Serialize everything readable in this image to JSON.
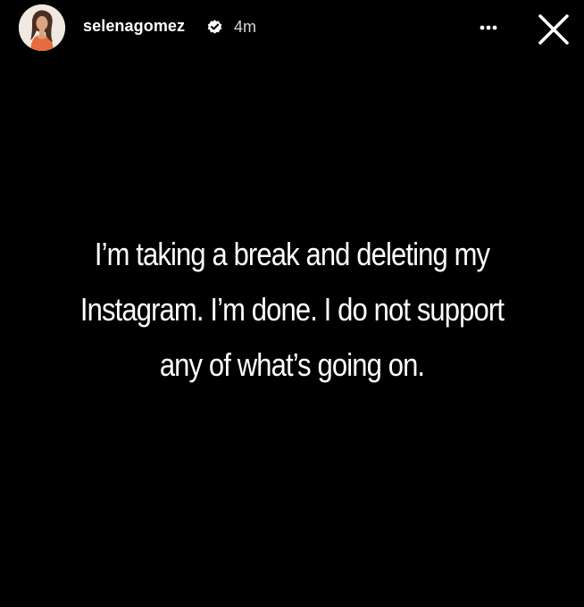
{
  "story": {
    "header": {
      "username": "selenagomez",
      "timestamp": "4m",
      "verified_icon": "verified-badge-icon",
      "more_icon": "more-options-icon",
      "close_icon": "close-icon"
    },
    "text_lines": [
      "I’m taking a break and deleting my",
      "Instagram. I’m done. I do not support",
      "any of what’s going on."
    ]
  },
  "colors": {
    "background": "#000000",
    "text": "#ffffff",
    "timestamp": "#d6d6d6"
  }
}
